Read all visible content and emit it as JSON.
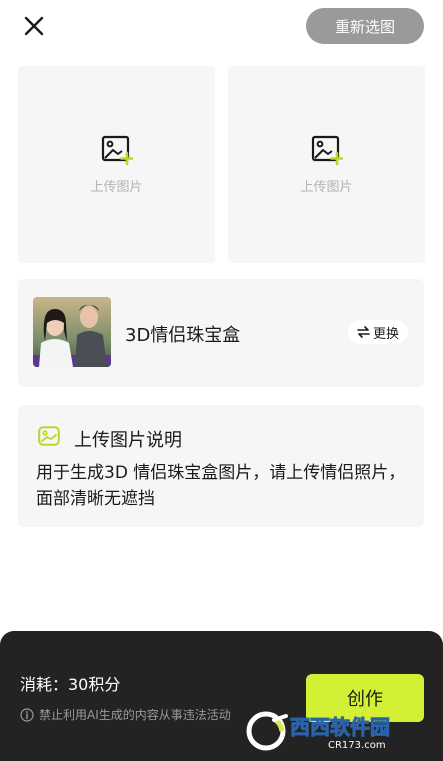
{
  "header": {
    "close_icon": "close-icon",
    "reselect_label": "重新选图"
  },
  "upload_slots": [
    {
      "label": "上传图片",
      "icon": "image-upload-icon"
    },
    {
      "label": "上传图片",
      "icon": "image-upload-icon"
    }
  ],
  "template": {
    "title": "3D情侣珠宝盒",
    "change_label": "更换",
    "change_icon": "swap-icon"
  },
  "instructions": {
    "title": "上传图片说明",
    "body": "用于生成3D 情侣珠宝盒图片，请上传情侣照片，面部清晰无遮挡",
    "icon": "image-icon"
  },
  "footer": {
    "cost_text": "消耗：30积分",
    "warning_text": "禁止利用AI生成的内容从事违法活动",
    "warning_icon": "info-icon",
    "create_label": "创作"
  },
  "watermark": {
    "brand": "西西软件园",
    "url": "CR173.com"
  },
  "colors": {
    "accent": "#d4f035",
    "panel": "#232323",
    "card": "#f6f6f6",
    "button_gray": "#9a9a9a"
  }
}
